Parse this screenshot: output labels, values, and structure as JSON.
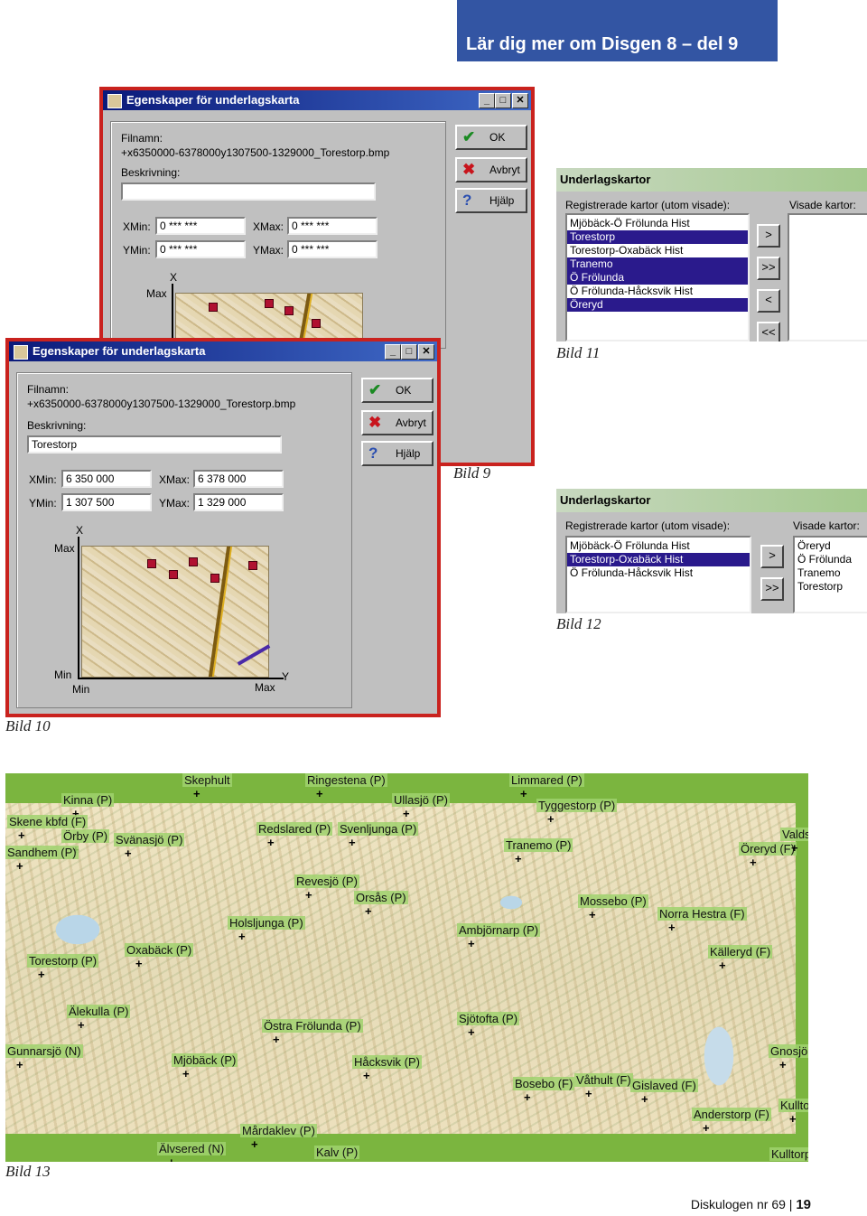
{
  "header": {
    "title": "Lär dig mer om Disgen 8 – del 9"
  },
  "dialog": {
    "title": "Egenskaper för underlagskarta",
    "filename_label": "Filnamn:",
    "filename": "+x6350000-6378000y1307500-1329000_Torestorp.bmp",
    "description_label": "Beskrivning:",
    "xmin_label": "XMin:",
    "xmax_label": "XMax:",
    "ymin_label": "YMin:",
    "ymax_label": "YMax:",
    "ok": "OK",
    "cancel": "Avbryt",
    "help": "Hjälp",
    "axis_x": "X",
    "axis_y": "Y",
    "max": "Max",
    "min": "Min"
  },
  "dialog_back": {
    "description": "",
    "xmin": "0 *** ***",
    "xmax": "0 *** ***",
    "ymin": "0 *** ***",
    "ymax": "0 *** ***"
  },
  "dialog_front": {
    "description": "Torestorp",
    "xmin": "6 350 000",
    "xmax": "6 378 000",
    "ymin": "1 307 500",
    "ymax": "1 329 000"
  },
  "underlag": {
    "title": "Underlagskartor",
    "registered_label": "Registrerade kartor (utom visade):",
    "shown_label": "Visade kartor:"
  },
  "bild11_list": [
    {
      "text": "Mjöbäck-Ö Frölunda Hist",
      "sel": false
    },
    {
      "text": "Torestorp",
      "sel": true
    },
    {
      "text": "Torestorp-Oxabäck Hist",
      "sel": false
    },
    {
      "text": "Tranemo",
      "sel": true
    },
    {
      "text": "Ö Frölunda",
      "sel": true
    },
    {
      "text": "Ö Frölunda-Håcksvik Hist",
      "sel": false
    },
    {
      "text": "Öreryd",
      "sel": true
    }
  ],
  "bild12_list": [
    {
      "text": "Mjöbäck-Ö Frölunda Hist",
      "sel": false
    },
    {
      "text": "Torestorp-Oxabäck Hist",
      "sel": true
    },
    {
      "text": "Ö Frölunda-Håcksvik Hist",
      "sel": false
    }
  ],
  "bild12_shown": [
    "Öreryd",
    "Ö Frölunda",
    "Tranemo",
    "Torestorp"
  ],
  "arrows": {
    "one": ">",
    "all": ">>",
    "back": "<",
    "back_all": "<<"
  },
  "captions": {
    "bild9": "Bild 9",
    "bild10": "Bild 10",
    "bild11": "Bild 11",
    "bild12": "Bild 12",
    "bild13": "Bild 13"
  },
  "places": [
    "Ringestena (P)",
    "Limmared (P)",
    "Kinna (P)",
    "Ullasjö (P)",
    "Tyggestorp (P)",
    "Skene kbfd (F)",
    "Redslared (P)",
    "Svenljunga (P)",
    "Örby (P)",
    "Svänasjö (P)",
    "Tranemo (P)",
    "Öreryd (F)",
    "Valds",
    "Revesjö (P)",
    "Orsås (P)",
    "Mossebo (P)",
    "Holsljunga (P)",
    "Norra Hestra (F)",
    "Ambjörnarp (P)",
    "Oxabäck (P)",
    "Torestorp (P)",
    "Källeryd (F)",
    "Älekulla (P)",
    "Sjötofta (P)",
    "Östra Frölunda (P)",
    "Gunnarsjö (N)",
    "Mjöbäck (P)",
    "Håcksvik (P)",
    "Gnosjö",
    "Bosebo (F)",
    "Våthult (F)",
    "Gislaved (F)",
    "Kullto",
    "Anderstorp (F)",
    "Mårdaklev (P)",
    "Älvsered (N)",
    "Kalv (P)",
    "Kulltorp",
    "Sandhem (P)",
    "Skephult"
  ],
  "footer": {
    "text": "Diskulogen nr 69 |",
    "page": "19"
  }
}
